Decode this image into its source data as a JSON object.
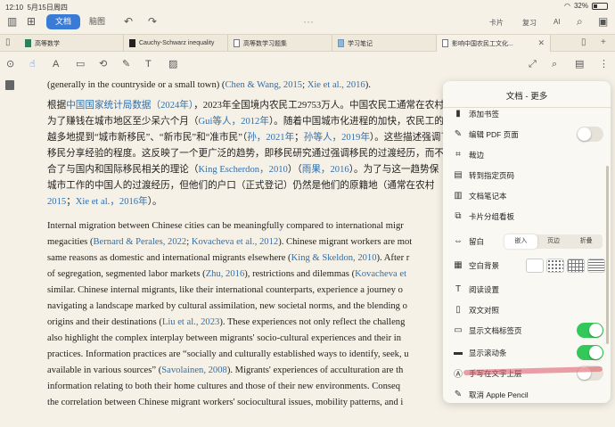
{
  "status": {
    "time": "12:10",
    "date": "5月15日周四",
    "battery": "32%",
    "battery_level": 0.32
  },
  "topbar": {
    "doc_tab": "文档",
    "brain_tab": "脑图",
    "card": "卡片",
    "review": "复习",
    "ai": "AI"
  },
  "tabs": [
    {
      "label": "高等数学",
      "icon": "book"
    },
    {
      "label": "Cauchy-Schwarz inequality",
      "icon": "dark"
    },
    {
      "label": "高等数学习题集",
      "icon": "page"
    },
    {
      "label": "学习笔记",
      "icon": "blue"
    },
    {
      "label": "影响中国农民工文化...",
      "icon": "page",
      "active": true
    }
  ],
  "content": {
    "p1_line1_a": "(generally in the countryside or a small town) (",
    "p1_line1_c1": "Chen & Wang, 2015",
    "p1_line1_sep": "; ",
    "p1_line1_c2": "Xie et al., 2016",
    "p1_line1_end": ").",
    "zh_line1_a": "根据",
    "zh_line1_c": "中国国家统计局数据（2024年）",
    "zh_line1_b": "，2023年全国境内农民工29753万人。中国农民工通常在农村",
    "zh_line2_a": "为了赚钱在城市地区至少呆六个月（",
    "zh_line2_c": "Gui等人，2012年",
    "zh_line2_b": "）。随着中国城市化进程的加快，农民工的",
    "zh_line3_a": "越多地提到“城市新移民”、“新市民”和“准市民”（",
    "zh_line3_c1": "孙，2021年",
    "zh_line3_sep": "；",
    "zh_line3_c2": "孙等人，2019年",
    "zh_line3_b": "）。这些描述强调了",
    "zh_line4": "移民分享经验的程度。这反映了一个更广泛的趋势，即移民研究通过强调移民的过渡经历，而不是",
    "zh_line5_a": "合了与国内和国际移民相关的理论（",
    "zh_line5_c1": "King Escherdon，2010",
    "zh_line5_sep": "）（",
    "zh_line5_c2": "雨果，2016",
    "zh_line5_b": "）。为了与这一趋势保",
    "zh_line6": "城市工作的中国人的过渡经历，但他们的户口（正式登记）仍然是他们的原籍地（通常在农村",
    "zh_line7_c1": "2015",
    "zh_line7_sep": "；",
    "zh_line7_c2": "Xie et al.，2016年",
    "zh_line7_end": "）。",
    "p2_l1": "Internal migration between Chinese cities can be meaningfully compared to international migr",
    "p2_l2_a": "megacities (",
    "p2_l2_c1": "Bernard & Perales, 2022",
    "p2_l2_sep": "; ",
    "p2_l2_c2": "Kovacheva et al., 2012",
    "p2_l2_b": "). Chinese migrant workers are mot",
    "p2_l3_a": "same reasons as domestic and international migrants elsewhere (",
    "p2_l3_c": "King & Skeldon, 2010",
    "p2_l3_b": "). After r",
    "p2_l4_a": "of segregation, segmented labor markets (",
    "p2_l4_c1": "Zhu, 2016",
    "p2_l4_b": "), restrictions and dilemmas (",
    "p2_l4_c2": "Kovacheva et",
    "p2_l5": "similar. Chinese internal migrants, like their international counterparts, experience a journey o",
    "p2_l6": "navigating a landscape marked by cultural assimilation, new societal norms, and the blending o",
    "p2_l7_a": "origins and their destinations (",
    "p2_l7_c": "Liu et al., 2023",
    "p2_l7_b": "). These experiences not only reflect the challeng",
    "p2_l8": "also highlight the complex interplay between migrants' socio-cultural experiences and their in",
    "p2_l9": "practices. Information practices are “socially and culturally established ways to identify, seek, u",
    "p2_l10_a": "available in various sources” (",
    "p2_l10_c": "Savolainen, 2008",
    "p2_l10_b": "). Migrants' experiences of acculturation are th",
    "p2_l11": "information relating to both their home cultures and those of their new environments. Conseq",
    "p2_l12": "the correlation between Chinese migrant workers' sociocultural issues, mobility patterns, and i"
  },
  "panel": {
    "title": "文档 - 更多",
    "items": [
      {
        "label": "添加书签",
        "icon": "bookmark-icon",
        "glyph": "▮"
      },
      {
        "label": "编辑 PDF 页面",
        "icon": "edit-pdf-icon",
        "glyph": "✎",
        "toggle": false
      },
      {
        "label": "裁边",
        "icon": "crop-icon",
        "glyph": "⌗"
      },
      {
        "label": "转到指定页码",
        "icon": "goto-page-icon",
        "glyph": "▤"
      },
      {
        "label": "文档笔记本",
        "icon": "notebook-icon",
        "glyph": "▥"
      },
      {
        "label": "卡片分组看板",
        "icon": "card-board-icon",
        "glyph": "⧉"
      },
      {
        "label": "留白",
        "icon": "margin-icon",
        "glyph": "⇔",
        "segments": [
          "嵌入",
          "页边",
          "折叠"
        ],
        "selected": 0
      },
      {
        "label": "空白背景",
        "icon": "background-icon",
        "glyph": "▦"
      },
      {
        "label": "阅读设置",
        "icon": "reading-settings-icon",
        "glyph": "T"
      },
      {
        "label": "双文对照",
        "icon": "bilingual-icon",
        "glyph": "▯"
      },
      {
        "label": "显示文档标签页",
        "icon": "doc-tabs-icon",
        "glyph": "▭",
        "toggle": true
      },
      {
        "label": "显示滚动条",
        "icon": "scrollbar-icon",
        "glyph": "▬",
        "toggle": true
      },
      {
        "label": "手写在文字上层",
        "icon": "handwriting-icon",
        "glyph": "Ⓐ",
        "toggle": false
      },
      {
        "label": "取消 Apple Pencil",
        "icon": "pencil-icon",
        "glyph": "✎"
      }
    ]
  },
  "colors": {
    "accent": "#3a7bd5",
    "cite": "#2f6fae",
    "toggle_on": "#34c759",
    "page_bg": "#f6f1e6"
  }
}
